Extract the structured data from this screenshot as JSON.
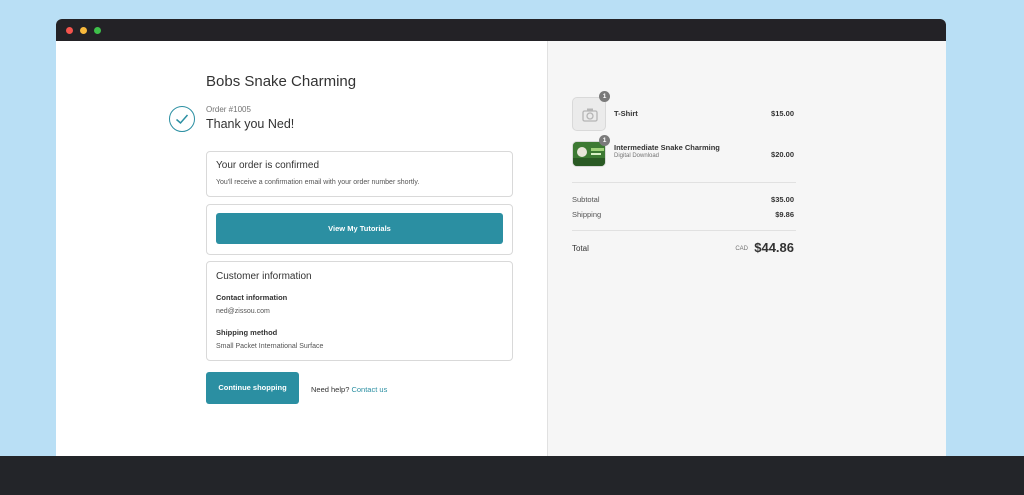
{
  "store": {
    "name": "Bobs Snake Charming"
  },
  "order": {
    "number": "Order #1005",
    "thanks": "Thank you Ned!"
  },
  "confirmation": {
    "title": "Your order is confirmed",
    "message": "You'll receive a confirmation email with your order number shortly."
  },
  "actions": {
    "tutorials_label": "View My Tutorials",
    "continue_label": "Continue shopping"
  },
  "customer": {
    "title": "Customer information",
    "contact_label": "Contact information",
    "contact_value": "ned@zissou.com",
    "shipping_label": "Shipping method",
    "shipping_value": "Small Packet International Surface"
  },
  "help": {
    "text": "Need help?",
    "link": "Contact us"
  },
  "items": [
    {
      "name": "T-Shirt",
      "subtitle": "",
      "qty": "1",
      "price": "$15.00"
    },
    {
      "name": "Intermediate Snake Charming",
      "subtitle": "Digital Download",
      "qty": "1",
      "price": "$20.00"
    }
  ],
  "summary": {
    "subtotal_label": "Subtotal",
    "subtotal_value": "$35.00",
    "shipping_label": "Shipping",
    "shipping_value": "$9.86",
    "total_label": "Total",
    "currency": "CAD",
    "total_value": "$44.86"
  },
  "colors": {
    "accent": "#2b8fa2",
    "titlebar": "#232226",
    "backdrop": "#b9dff5"
  }
}
